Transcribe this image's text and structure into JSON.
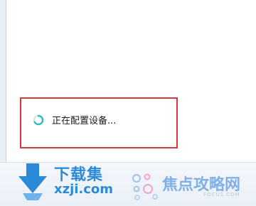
{
  "status": {
    "message": "正在配置设备..."
  },
  "watermarks": {
    "xzj": {
      "title": "下载集",
      "url": "xzji.com"
    },
    "focus": {
      "title": "焦点攻略网",
      "subtitle": "FOCUS.COM"
    }
  },
  "colors": {
    "highlight_border": "#d9363e",
    "spinner": "#3ab7c4",
    "watermark_blue": "#2b8ad8",
    "watermark_light_blue": "#7fb0e6"
  }
}
